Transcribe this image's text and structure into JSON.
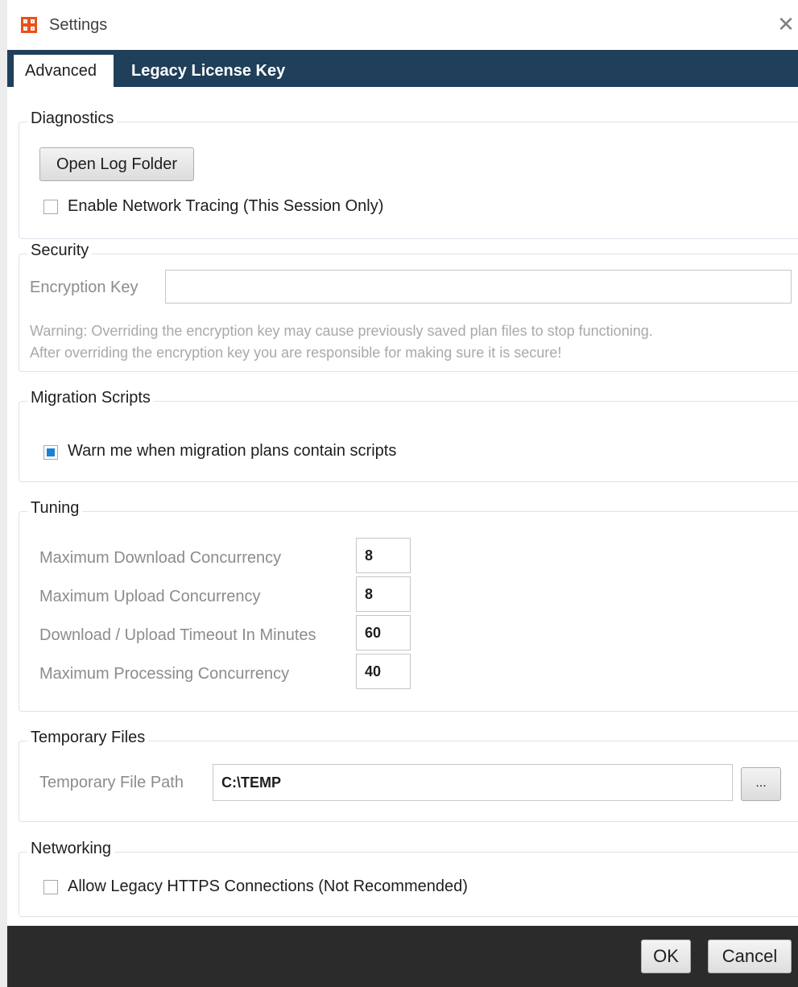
{
  "window": {
    "title": "Settings",
    "close_glyph": "✕"
  },
  "tabs": [
    {
      "label": "Advanced",
      "active": true
    },
    {
      "label": "Legacy License Key",
      "active": false
    }
  ],
  "diagnostics": {
    "legend": "Diagnostics",
    "open_log_folder_label": "Open Log Folder",
    "network_tracing_label": "Enable Network Tracing (This Session Only)",
    "network_tracing_checked": false
  },
  "security": {
    "legend": "Security",
    "encryption_key_label": "Encryption Key",
    "encryption_key_value": "",
    "warning_line1": "Warning: Overriding the encryption key may cause previously saved plan files to stop functioning.",
    "warning_line2": "After overriding the encryption key you are responsible for making sure it is secure!"
  },
  "migration": {
    "legend": "Migration Scripts",
    "warn_label": "Warn me when migration plans contain scripts",
    "warn_checked": true
  },
  "tuning": {
    "legend": "Tuning",
    "rows": [
      {
        "label": "Maximum Download Concurrency",
        "value": "8"
      },
      {
        "label": "Maximum Upload Concurrency",
        "value": "8"
      },
      {
        "label": "Download / Upload Timeout In Minutes",
        "value": "60"
      },
      {
        "label": "Maximum Processing Concurrency",
        "value": "40"
      }
    ]
  },
  "temp_files": {
    "legend": "Temporary Files",
    "path_label": "Temporary File Path",
    "path_value": "C:\\TEMP",
    "browse_label": "..."
  },
  "networking": {
    "legend": "Networking",
    "legacy_https_label": "Allow Legacy HTTPS Connections (Not Recommended)",
    "legacy_https_checked": false
  },
  "footer": {
    "ok_label": "OK",
    "cancel_label": "Cancel"
  },
  "colors": {
    "tab_bar": "#1f3f5a",
    "footer": "#2b2b2b",
    "check_fill": "#1a82d6",
    "app_icon": "#e8501a"
  }
}
